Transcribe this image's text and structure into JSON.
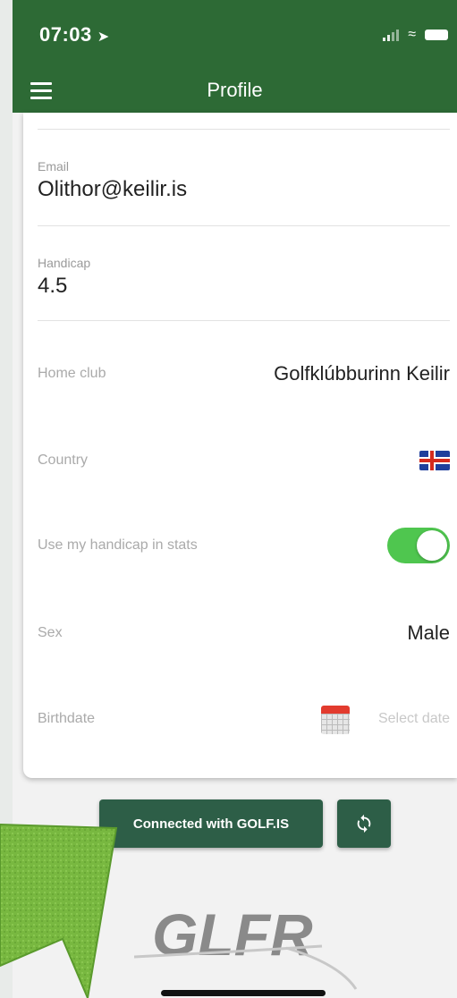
{
  "status_bar": {
    "time": "07:03",
    "location_glyph": "➤"
  },
  "app_bar": {
    "title": "Profile"
  },
  "profile": {
    "email": {
      "label": "Email",
      "value": "Olithor@keilir.is"
    },
    "handicap": {
      "label": "Handicap",
      "value": "4.5"
    },
    "home_club": {
      "label": "Home club",
      "value": "Golfklúbburinn Keilir"
    },
    "country": {
      "label": "Country",
      "flag_icon": "iceland-flag-icon"
    },
    "use_handicap": {
      "label": "Use my handicap in stats",
      "on": true
    },
    "sex": {
      "label": "Sex",
      "value": "Male"
    },
    "birthdate": {
      "label": "Birthdate",
      "placeholder": "Select date"
    }
  },
  "actions": {
    "connected_label": "Connected with GOLF.IS",
    "sync_icon": "sync-icon"
  },
  "logo": {
    "text": "GLFR"
  },
  "colors": {
    "primary": "#2d6a35",
    "button": "#2d5e47",
    "toggle_on": "#4fc64f",
    "arrow": "#76b73f"
  }
}
